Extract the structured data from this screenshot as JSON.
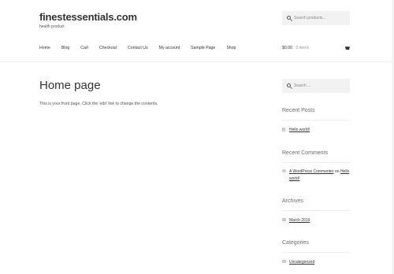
{
  "site": {
    "title": "finestessentials.com",
    "tagline": "health product"
  },
  "header_search": {
    "placeholder": "Search products..."
  },
  "nav": {
    "items": [
      "Home",
      "Blog",
      "Cart",
      "Checkout",
      "Contact Us",
      "My account",
      "Sample Page",
      "Shop"
    ]
  },
  "cart": {
    "amount": "$0.00",
    "items": "0 items"
  },
  "page": {
    "title": "Home page",
    "body": "This is your front page. Click the 'edit' link to change the contents."
  },
  "sidebar": {
    "search_placeholder": "Search ...",
    "recent_posts": {
      "title": "Recent Posts",
      "items": [
        "Hello world!"
      ]
    },
    "recent_comments": {
      "title": "Recent Comments",
      "author": "A WordPress Commenter",
      "on": "on",
      "post": "Hello world!"
    },
    "archives": {
      "title": "Archives",
      "items": [
        "March 2019"
      ]
    },
    "categories": {
      "title": "Categories",
      "items": [
        "Uncategorized"
      ]
    }
  }
}
